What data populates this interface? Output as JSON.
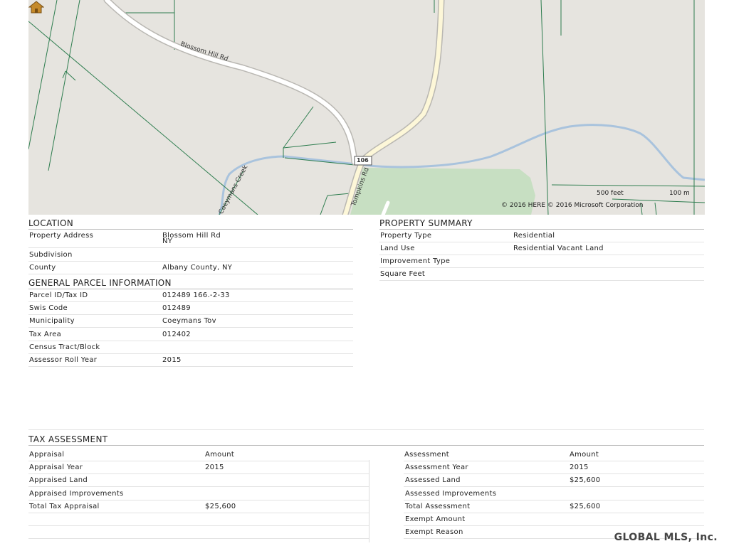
{
  "map": {
    "road_label": "Blossom Hill Rd",
    "route_shield": "106",
    "road_label_2": "Tompkins Rd",
    "creek_label": "Coeymans Creek",
    "scale_feet": "500 feet",
    "scale_m": "100 m",
    "copyright": "© 2016 HERE    © 2016 Microsoft Corporation",
    "colors": {
      "land": "#e6e4df",
      "park": "#c7dfc2",
      "water": "#a9c3dd",
      "parcel": "#2e7d4f",
      "road": "#ffffff"
    }
  },
  "location": {
    "title": "LOCATION",
    "rows": [
      {
        "label": "Property Address",
        "value": "Blossom Hill Rd",
        "value2": "NY"
      },
      {
        "label": "Subdivision",
        "value": ""
      },
      {
        "label": "County",
        "value": "Albany County, NY"
      }
    ]
  },
  "parcel": {
    "title": "GENERAL PARCEL INFORMATION",
    "rows": [
      {
        "label": "Parcel ID/Tax ID",
        "value": "012489 166.-2-33"
      },
      {
        "label": "Swis Code",
        "value": "012489"
      },
      {
        "label": "Municipality",
        "value": "Coeymans Tov"
      },
      {
        "label": "Tax Area",
        "value": "012402"
      },
      {
        "label": "Census Tract/Block",
        "value": ""
      },
      {
        "label": "Assessor Roll Year",
        "value": "2015"
      }
    ]
  },
  "summary": {
    "title": "PROPERTY SUMMARY",
    "rows": [
      {
        "label": "Property Type",
        "value": "Residential"
      },
      {
        "label": "Land Use",
        "value": "Residential Vacant Land"
      },
      {
        "label": "Improvement Type",
        "value": ""
      },
      {
        "label": "Square Feet",
        "value": ""
      }
    ]
  },
  "tax": {
    "title": "TAX ASSESSMENT",
    "left_headers": [
      "Appraisal",
      "Amount"
    ],
    "right_headers": [
      "Assessment",
      "Amount"
    ],
    "left_rows": [
      {
        "label": "Appraisal Year",
        "value": "2015"
      },
      {
        "label": "Appraised Land",
        "value": ""
      },
      {
        "label": "Appraised Improvements",
        "value": ""
      },
      {
        "label": "Total Tax Appraisal",
        "value": "$25,600"
      }
    ],
    "right_rows": [
      {
        "label": "Assessment Year",
        "value": "2015"
      },
      {
        "label": "Assessed Land",
        "value": "$25,600"
      },
      {
        "label": "Assessed Improvements",
        "value": ""
      },
      {
        "label": "Total Assessment",
        "value": "$25,600"
      },
      {
        "label": "Exempt Amount",
        "value": ""
      },
      {
        "label": "Exempt Reason",
        "value": ""
      }
    ]
  },
  "footer": {
    "brand": "GLOBAL MLS, Inc."
  }
}
